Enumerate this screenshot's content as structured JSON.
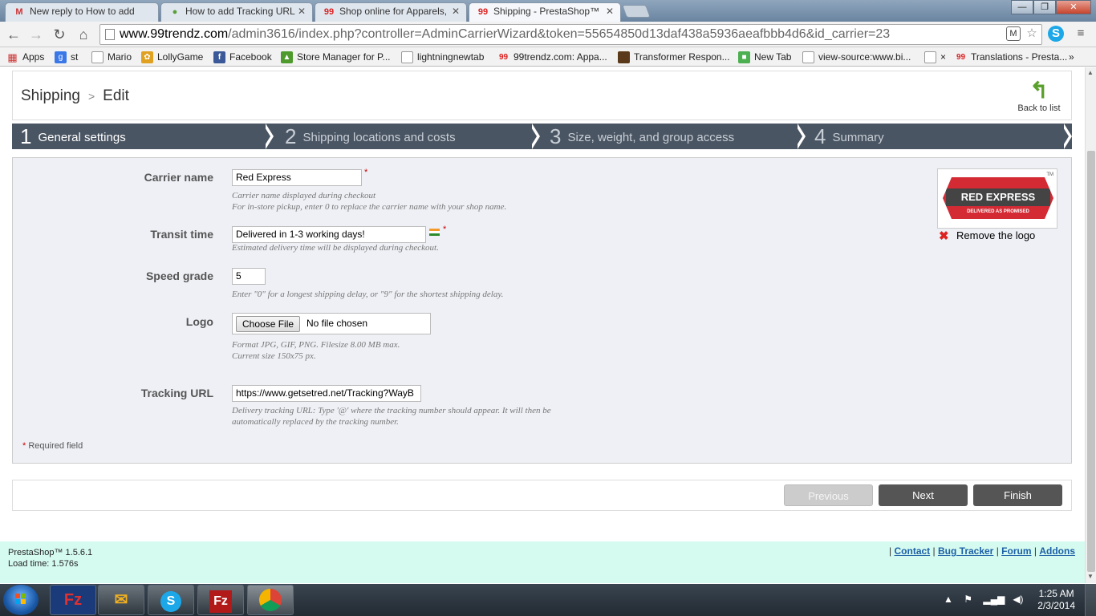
{
  "browser": {
    "tabs": [
      {
        "label": "New reply to How to add",
        "icon": "gmail-icon"
      },
      {
        "label": "How to add Tracking URL",
        "icon": "prestashop-forum-icon"
      },
      {
        "label": "Shop online for Apparels,",
        "icon": "99trendz-icon"
      },
      {
        "label": "Shipping - PrestaShop™",
        "icon": "99trendz-icon"
      }
    ],
    "url_host": "www.99trendz.com",
    "url_rest": "/admin3616/index.php?controller=AdminCarrierWizard&token=55654850d13daf438a5936aeafbbb4d6&id_carrier=23",
    "bookmarks": [
      {
        "label": "Apps"
      },
      {
        "label": "st"
      },
      {
        "label": "Mario"
      },
      {
        "label": "LollyGame"
      },
      {
        "label": "Facebook"
      },
      {
        "label": "Store Manager for P..."
      },
      {
        "label": "lightningnewtab"
      },
      {
        "label": "99trendz.com: Appa..."
      },
      {
        "label": "Transformer Respon..."
      },
      {
        "label": "New Tab"
      },
      {
        "label": "view-source:www.bi..."
      },
      {
        "label": "×"
      },
      {
        "label": "Translations - Presta..."
      }
    ],
    "more_bookmarks": "»"
  },
  "header": {
    "breadcrumb_section": "Shipping",
    "breadcrumb_sep": ">",
    "breadcrumb_page": "Edit",
    "back_label": "Back to list"
  },
  "steps": [
    {
      "num": "1",
      "label": "General settings"
    },
    {
      "num": "2",
      "label": "Shipping locations and costs"
    },
    {
      "num": "3",
      "label": "Size, weight, and group access"
    },
    {
      "num": "4",
      "label": "Summary"
    }
  ],
  "form": {
    "carrier_name_label": "Carrier name",
    "carrier_name_value": "Red Express",
    "carrier_name_hint1": "Carrier name displayed during checkout",
    "carrier_name_hint2": "For in-store pickup, enter 0 to replace the carrier name with your shop name.",
    "transit_label": "Transit time",
    "transit_value": "Delivered in 1-3 working days!",
    "transit_hint": "Estimated delivery time will be displayed during checkout.",
    "speed_label": "Speed grade",
    "speed_value": "5",
    "speed_hint": "Enter \"0\" for a longest shipping delay, or \"9\" for the shortest shipping delay.",
    "logo_label": "Logo",
    "choose_file": "Choose File",
    "no_file": "No file chosen",
    "logo_hint1": "Format JPG, GIF, PNG. Filesize 8.00 MB max.",
    "logo_hint2": "Current size 150x75 px.",
    "tracking_label": "Tracking URL",
    "tracking_value": "https://www.getsetred.net/Tracking?WayB",
    "tracking_hint1": "Delivery tracking URL: Type '@' where the tracking number should appear. It will then be",
    "tracking_hint2": "automatically replaced by the tracking number.",
    "required_star": "*",
    "required_note": "Required field",
    "logo_text": "RED EXPRESS",
    "logo_tagline": "DELIVERED AS PROMISED",
    "logo_tm": "TM",
    "remove_logo": "Remove the logo"
  },
  "buttons": {
    "previous": "Previous",
    "next": "Next",
    "finish": "Finish"
  },
  "footer": {
    "version": "PrestaShop™ 1.5.6.1",
    "load_time": "Load time: 1.576s",
    "links": [
      "Contact",
      "Bug Tracker",
      "Forum",
      "Addons"
    ],
    "link_sep": "|"
  },
  "taskbar": {
    "time": "1:25 AM",
    "date": "2/3/2014"
  },
  "colors": {
    "steps_bg": "#4a5563",
    "form_bg": "#eef0f5",
    "footer_bg": "#d5fbf0",
    "button_dark": "#555555",
    "link": "#1d5fa6"
  }
}
